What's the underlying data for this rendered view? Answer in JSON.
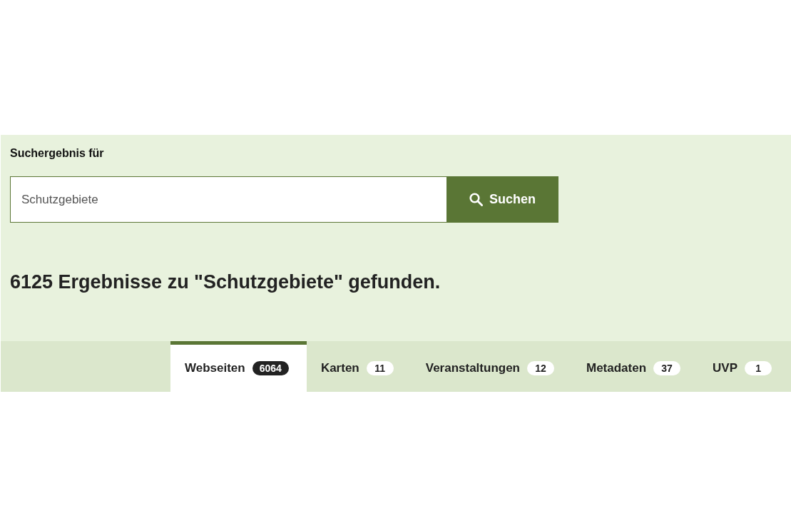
{
  "search": {
    "label": "Suchergebnis für",
    "value": "Schutzgebiete",
    "button": "Suchen"
  },
  "result_heading": "6125 Ergebnisse zu \"Schutzgebiete\" gefunden.",
  "tabs": [
    {
      "label": "Webseiten",
      "count": "6064",
      "selected": true
    },
    {
      "label": "Karten",
      "count": "11",
      "selected": false
    },
    {
      "label": "Veranstaltungen",
      "count": "12",
      "selected": false
    },
    {
      "label": "Metadaten",
      "count": "37",
      "selected": false
    },
    {
      "label": "UVP",
      "count": "1",
      "selected": false
    }
  ]
}
